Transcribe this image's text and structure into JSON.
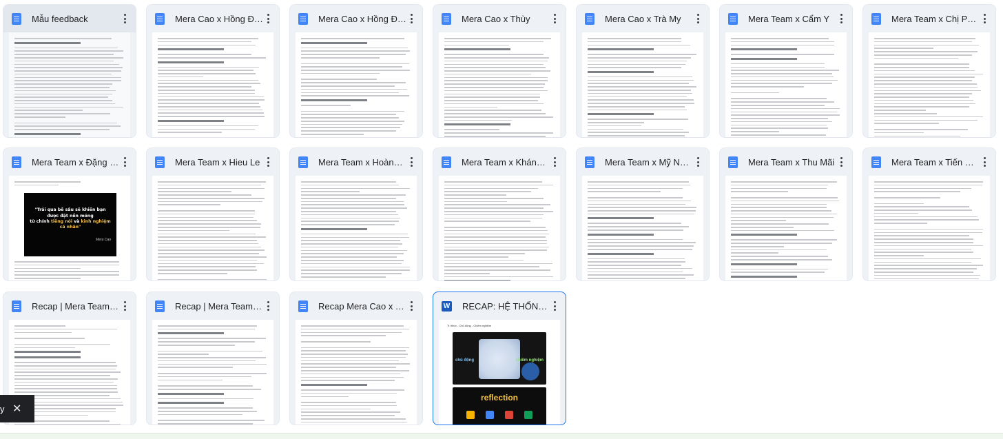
{
  "files": [
    {
      "title": "Mẫu feedback",
      "icon": "docs-icon"
    },
    {
      "title": "Mera Cao x Hồng Đoàn",
      "icon": "docs-icon"
    },
    {
      "title": "Mera Cao x Hồng Đoàn",
      "icon": "docs-icon"
    },
    {
      "title": "Mera Cao x Thùy",
      "icon": "docs-icon"
    },
    {
      "title": "Mera Cao x Trà My",
      "icon": "docs-icon"
    },
    {
      "title": "Mera Team x Cẩm Y",
      "icon": "docs-icon"
    },
    {
      "title": "Mera Team x Chị Phư...",
      "icon": "docs-icon"
    },
    {
      "title": "Mera Team x Đặng Hi...",
      "icon": "docs-icon"
    },
    {
      "title": "Mera Team x Hieu Le",
      "icon": "docs-icon"
    },
    {
      "title": "Mera Team x Hoàng ...",
      "icon": "docs-icon"
    },
    {
      "title": "Mera Team x Khánh H...",
      "icon": "docs-icon"
    },
    {
      "title": "Mera Team x Mỹ Ngọc",
      "icon": "docs-icon"
    },
    {
      "title": "Mera Team x Thu Mãi",
      "icon": "docs-icon"
    },
    {
      "title": "Mera Team x Tiến Ph...",
      "icon": "docs-icon"
    },
    {
      "title": "Recap | Mera Team x ...",
      "icon": "docs-icon"
    },
    {
      "title": "Recap | Mera Team x ...",
      "icon": "docs-icon"
    },
    {
      "title": "Recap Mera Cao x Tú ...",
      "icon": "docs-icon"
    },
    {
      "title": "RECAP: HỆ THỐNG H...",
      "icon": "word-icon"
    }
  ],
  "word_icon_letter": "W",
  "quote_thumb": {
    "line1": "\"Trải qua bề sâu sẽ khiến bạn",
    "line2": "được đặt nền móng",
    "line3a": "từ chính ",
    "line3b": "tiếng nói",
    "line3c": " và ",
    "line3d": "kinh nghiệm cá nhân\"",
    "signature": "Mera Cao"
  },
  "recap_thumb": {
    "caption": "Trí thức - Chủ động - Chiêm nghiệm",
    "left_label": "chủ động",
    "right_label": "chiêm nghiệm",
    "bottom_title": "reflection"
  },
  "toast": {
    "text": "y",
    "close": "✕"
  }
}
